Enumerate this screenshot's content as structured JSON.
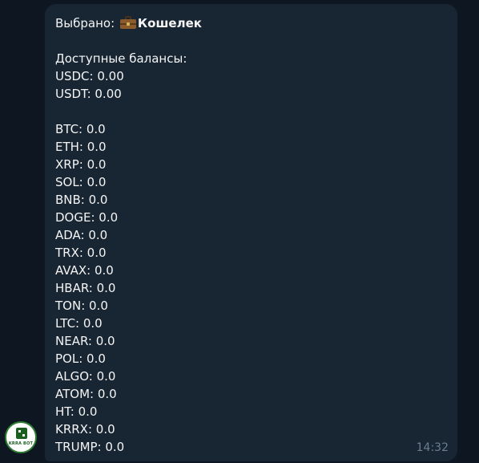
{
  "message": {
    "title_prefix": "Выбрано:",
    "title_icon": "briefcase-emoji",
    "title_bold": "Кошелек",
    "available_label": "Доступные балансы:",
    "stable_balances": [
      "USDC: 0.00",
      "USDT: 0.00"
    ],
    "coin_balances": [
      "BTC: 0.0",
      "ETH: 0.0",
      "XRP: 0.0",
      "SOL: 0.0",
      "BNB: 0.0",
      "DOGE: 0.0",
      "ADA: 0.0",
      "TRX: 0.0",
      "AVAX: 0.0",
      "HBAR: 0.0",
      "TON: 0.0",
      "LTC: 0.0",
      "NEAR: 0.0",
      "POL: 0.0",
      "ALGO: 0.0",
      "ATOM: 0.0",
      "HT: 0.0",
      "KRRX: 0.0",
      "TRUMP: 0.0"
    ],
    "time": "14:32"
  },
  "avatar": {
    "logo_text": "KRRA BOT",
    "icon": "bot-logo-icon"
  },
  "colors": {
    "background": "#0e1621",
    "bubble": "#182533",
    "text": "#f5f5f5",
    "timestamp": "#6d7f8f"
  }
}
